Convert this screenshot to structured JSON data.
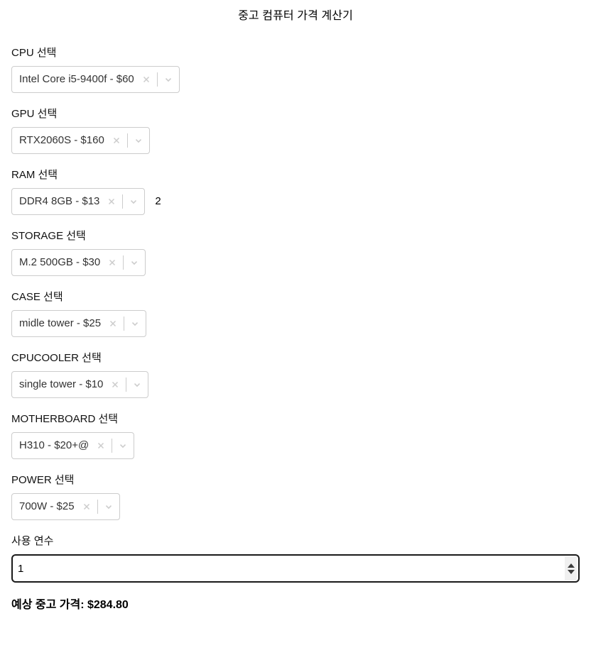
{
  "app": {
    "title": "중고 컴퓨터 가격 계산기"
  },
  "fields": [
    {
      "key": "cpu",
      "label": "CPU 선택",
      "value": "Intel Core i5-9400f - $60",
      "clear_icon": "close-icon",
      "dropdown_icon": "chevron-down-icon"
    },
    {
      "key": "gpu",
      "label": "GPU 선택",
      "value": "RTX2060S - $160",
      "clear_icon": "close-icon",
      "dropdown_icon": "chevron-down-icon"
    },
    {
      "key": "ram",
      "label": "RAM 선택",
      "value": "DDR4 8GB - $13",
      "quantity": "2",
      "clear_icon": "close-icon",
      "dropdown_icon": "chevron-down-icon"
    },
    {
      "key": "storage",
      "label": "STORAGE 선택",
      "value": "M.2 500GB - $30",
      "clear_icon": "close-icon",
      "dropdown_icon": "chevron-down-icon"
    },
    {
      "key": "case",
      "label": "CASE 선택",
      "value": "midle tower - $25",
      "clear_icon": "close-icon",
      "dropdown_icon": "chevron-down-icon"
    },
    {
      "key": "cpucooler",
      "label": "CPUCOOLER 선택",
      "value": "single tower - $10",
      "clear_icon": "close-icon",
      "dropdown_icon": "chevron-down-icon"
    },
    {
      "key": "motherboard",
      "label": "MOTHERBOARD 선택",
      "value": "H310 - $20+@",
      "clear_icon": "close-icon",
      "dropdown_icon": "chevron-down-icon"
    },
    {
      "key": "power",
      "label": "POWER 선택",
      "value": "700W - $25",
      "clear_icon": "close-icon",
      "dropdown_icon": "chevron-down-icon"
    }
  ],
  "years_field": {
    "label": "사용 연수",
    "value": "1",
    "spinner_up_icon": "triangle-up-icon",
    "spinner_down_icon": "triangle-down-icon"
  },
  "result": {
    "text": "예상 중고 가격: $284.80"
  },
  "colors": {
    "border": "#cccccc",
    "indicator": "#cccccc",
    "value_text": "#333333",
    "focus_border": "#1a1a1a",
    "background": "#ffffff"
  }
}
